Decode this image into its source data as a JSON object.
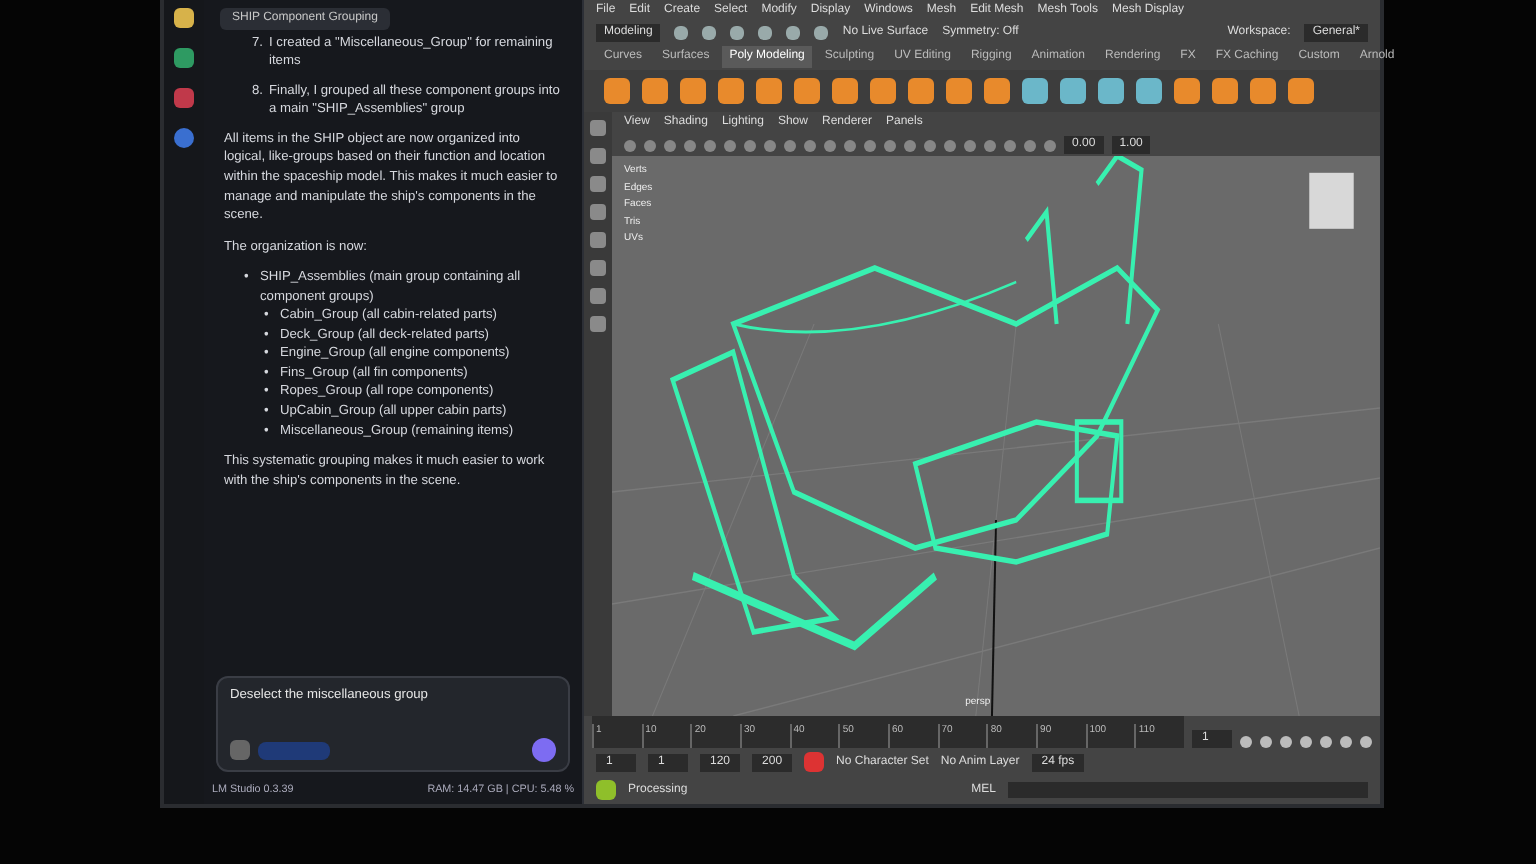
{
  "chat": {
    "tab": "SHIP Component Grouping",
    "steps": [
      {
        "number": "7.",
        "text": "I created a \"Miscellaneous_Group\" for remaining items"
      },
      {
        "number": "8.",
        "text": "Finally, I grouped all these component groups into a main \"SHIP_Assemblies\" group"
      }
    ],
    "summary": "All items in the SHIP object are now organized into logical, like-groups based on their function and location within the spaceship model. This makes it much easier to manage and manipulate the ship's components in the scene.",
    "intro": "The organization is now:",
    "groups": [
      {
        "marker": "•",
        "text": "SHIP_Assemblies (main group containing all component groups)",
        "children": [
          {
            "marker": "•",
            "text": "Cabin_Group (all cabin-related parts)"
          },
          {
            "marker": "•",
            "text": "Deck_Group (all deck-related parts)"
          },
          {
            "marker": "•",
            "text": "Engine_Group (all engine components)"
          },
          {
            "marker": "•",
            "text": "Fins_Group (all fin components)"
          },
          {
            "marker": "•",
            "text": "Ropes_Group (all rope components)"
          },
          {
            "marker": "•",
            "text": "UpCabin_Group (all upper cabin parts)"
          },
          {
            "marker": "•",
            "text": "Miscellaneous_Group (remaining items)"
          }
        ]
      }
    ],
    "closing": "This systematic grouping makes it much easier to work with the ship's components in the scene.",
    "input": {
      "value": "Deselect the miscellaneous group"
    },
    "footer": {
      "app_version": "LM Studio 0.3.39",
      "stats": "RAM: 14.47 GB | CPU: 5.48 %"
    }
  },
  "maya": {
    "menu": [
      "File",
      "Edit",
      "Create",
      "Select",
      "Modify",
      "Display",
      "Windows",
      "Mesh",
      "Edit Mesh",
      "Mesh Tools",
      "Mesh Display"
    ],
    "mode": "Modeling",
    "live_surface": "No Live Surface",
    "symmetry": "Symmetry: Off",
    "workspace_label": "Workspace:",
    "workspace": "General*",
    "shelf_tabs": [
      {
        "label": "Curves",
        "selected": false
      },
      {
        "label": "Surfaces",
        "selected": false
      },
      {
        "label": "Poly Modeling",
        "selected": true
      },
      {
        "label": "Sculpting",
        "selected": false
      },
      {
        "label": "UV Editing",
        "selected": false
      },
      {
        "label": "Rigging",
        "selected": false
      },
      {
        "label": "Animation",
        "selected": false
      },
      {
        "label": "Rendering",
        "selected": false
      },
      {
        "label": "FX",
        "selected": false
      },
      {
        "label": "FX Caching",
        "selected": false
      },
      {
        "label": "Custom",
        "selected": false
      },
      {
        "label": "Arnold",
        "selected": false
      }
    ],
    "panel_menu": [
      "View",
      "Shading",
      "Lighting",
      "Show",
      "Renderer",
      "Panels"
    ],
    "hud": [
      "Verts",
      "Edges",
      "Faces",
      "Tris",
      "UVs"
    ],
    "viewport_values": [
      "0.00",
      "1.00"
    ],
    "camera_label": "persp",
    "timeline": {
      "ticks": [
        "1",
        "10",
        "20",
        "30",
        "40",
        "50",
        "60",
        "70",
        "80",
        "90",
        "100",
        "110"
      ],
      "current_frame": "1"
    },
    "range": [
      "1",
      "1",
      "120",
      "200"
    ],
    "character_set": "No Character Set",
    "anim_layer": "No Anim Layer",
    "fps": "24 fps",
    "status": "Processing",
    "command_label": "MEL"
  }
}
